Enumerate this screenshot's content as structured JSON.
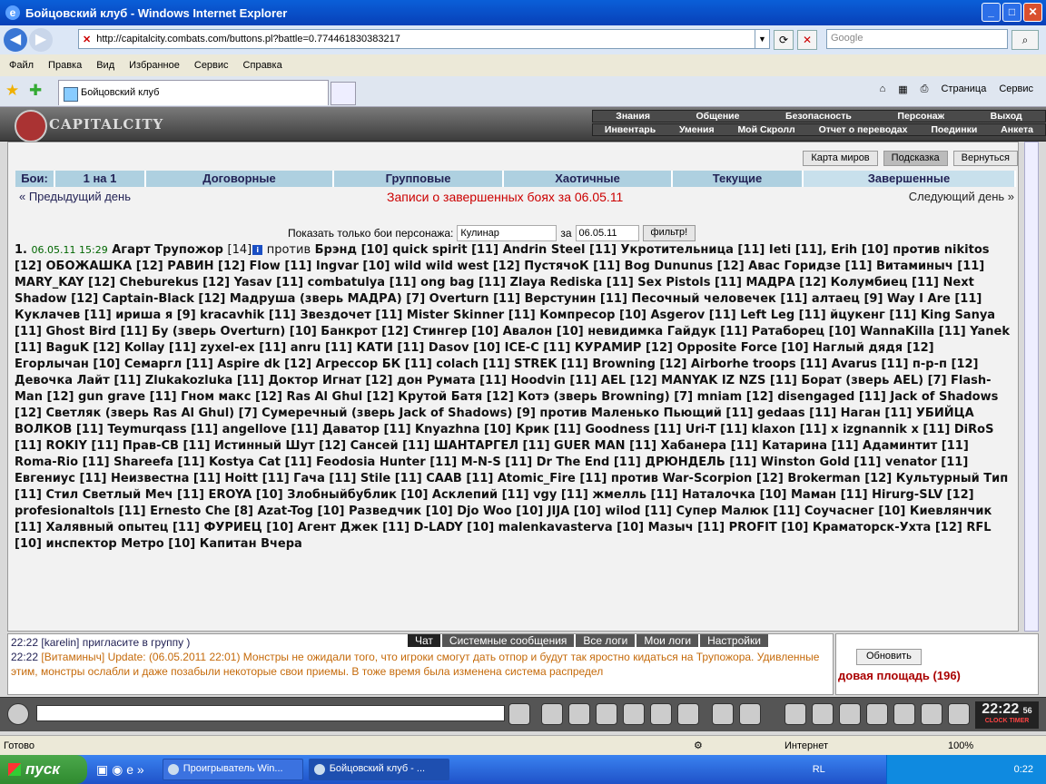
{
  "window": {
    "title": "Бойцовский клуб - Windows Internet Explorer",
    "minimize": "_",
    "maximize": "□",
    "close": "✕"
  },
  "address": {
    "url": "http://capitalcity.combats.com/buttons.pl?battle=0.774461830383217",
    "search_placeholder": "Google"
  },
  "menu": [
    "Файл",
    "Правка",
    "Вид",
    "Избранное",
    "Сервис",
    "Справка"
  ],
  "tab": {
    "title": "Бойцовский клуб"
  },
  "ie_toolbar": {
    "page": "Страница",
    "service": "Сервис"
  },
  "game": {
    "logo": "CAPITALCITY",
    "menu_row1": [
      "Знания",
      "Общение",
      "Безопасность",
      "Персонаж",
      "Выход"
    ],
    "menu_row2": [
      "Инвентарь",
      "Умения",
      "Мой Скролл",
      "Отчет о переводах",
      "Поединки",
      "Анкета"
    ],
    "top_buttons": [
      "Карта миров",
      "Подсказка",
      "Вернуться"
    ],
    "fights_label": "Бои:",
    "fight_tabs": [
      "1 на 1",
      "Договорные",
      "Групповые",
      "Хаотичные",
      "Текущие",
      "Завершенные"
    ],
    "prev_day": "« Предыдущий день",
    "heading": "Записи о завершенных боях за 06.05.11",
    "next_day": "Следующий день »",
    "filter_label": "Показать только бои персонажа:",
    "filter_name": "Кулинар",
    "filter_for": "за",
    "filter_date": "06.05.11",
    "filter_button": "фильтр!",
    "battle_num": "1.",
    "battle_time": "06.05.11 15:29",
    "battle_head": "Агарт Трупожор",
    "battle_head_lvl": "[14]",
    "vs": "против",
    "battle_text_rest": "Брэнд [10] quick spirit [11] Andrin Steel [11] Укротительница [11] Ieti [11], Erih [10] против nikitos [12] ОБОЖАШКА [12] РАВИН [12] Flow [11] Ingvar [10] wild wild west [12] ПустячоК [11] Bog Dununus [12] Авас Горидзе [11] Витаминыч [11] MARY_KAY [12] Cheburekus [12] Yasav [11] combatulya [11] ong bag [11] Zlaya Rediska [11] Sex Pistols [11] МАДРА [12] Колумбиец [11] Next Shadow [12] Captain-Black [12] Мадруша (зверь МАДРА) [7] Overturn [11] Верстунин [11] Песочный человечек [11] алтаец [9] Way I Are [11] Куклачев [11] ириша я [9] kracavhik [11] Звездочет [11] Mister Skinner [11] Компресор [10] Asgerov [11] Left Leg [11] йцукенг [11] King Sanya [11] Ghost Bird [11] Бу (зверь Overturn) [10] Банкрот [12] Стингер [10] Авалон [10] невидимка Гайдук [11] Ратаборец [10] WannaKilla [11] Yanek [11] BaguK [12] Kollay [11] zyxel-ex [11] anru [11] КАТИ [11] Dasov [10] ICE-C [11] КУРАМИР [12] Opposite Force [10] Наглый дядя [12] Егорлычан [10] Семаргл [11] Aspire dk [12] Агрессор БК [11] colach [11] STREK [11] Browning [12] Airborhe troops [11] Avarus [11] п-р-п [12] Девочка Лайт [11] Zlukakozluka [11] Доктор Игнат [12] дон Румата [11] Hoodvin [11] AEL [12] MANYAK IZ NZS [11] Борат (зверь AEL) [7] Flash-Man [12] gun grave [11] Гном макс [12] Ras Al Ghul [12] Крутой Батя [12] Котэ (зверь Browning) [7] mniam [12] disengaged [11] Jack of Shadows [12] Светляк (зверь Ras Al Ghul) [7] Сумеречный (зверь Jack of Shadows) [9] против Маленько Пьющий [11] gedaas [11] Наган [11] УБИЙЦА ВОЛКОВ [11] Teymurqass [11] angellove [11] Даватор [11] Knyazhna [10] Крик [11] Goodness [11] Uri-T [11] klaxon [11] x izgnannik x [11] DiRoS [11] ROKIY [11] Прав-СВ [11] Истинный Шут [12] Сансей [11] ШАНТАРГЕЛ [11] GUER MAN [11] Хабанера [11] Катарина [11] Адаминтит [11] Roma-Rio [11] Shareefa [11] Kostya Cat [11] Feodosia Hunter [11] M-N-S [11] Dr The End [11] ДРЮНДЕЛЬ [11] Winston Gold [11] venator [11] Евгениус [11] Неизвестна [11] Hoitt [11] Гача [11] Stile [11] CAAB [11] Atomic_Fire [11] против War-Scorpion [12] Brokerman [12] Культурный Тип [11] Стил Светлый Меч [11] EROYA [10] Злобныйбублик [10] Асклепий [11] vgy [11] жмелль [11] Наталочка [10] Маман [11] Hirurg-SLV [12] profesionaltols [11] Ernesto Che [8] Azat-Tog [10] Разведчик [10] Djo Woo [10] JIJA [10] wilod [11] Супер Малюк [11] Соучаснег [10] Киевлянчик [11] Халявный опытец [11] ФУРИЕЦ [10] Агент Джек [11] D-LADY [10] malenkavasterva [10] Мазыч [11] PROFIT [10] Краматорск-Ухта [12] RFL [10] инспектор Метро [10] Капитан Вчера"
  },
  "chat": {
    "tabs": [
      "Чат",
      "Системные сообщения",
      "Все логи",
      "Мои логи",
      "Настройки"
    ],
    "line1_time": "22:22",
    "line1_text": "[karelin] пригласите в группу )",
    "line2_time": "22:22",
    "line2_text": "[Витаминыч] Update: (06.05.2011 22:01) Монстры не ожидали того, что игроки смогут дать отпор и будут так яростно кидаться на Трупожора. Удивленные этим, монстры ослабли и даже позабыли некоторые свои приемы. В тоже время была изменена система распредел",
    "refresh_button": "Обновить",
    "location": "довая площадь (196)"
  },
  "clock": {
    "time": "22:22",
    "seconds": "56",
    "label": "CLOCK TIMER"
  },
  "status": {
    "left": "Готово",
    "zone": "Интернет",
    "zoom": "100%"
  },
  "taskbar": {
    "start": "пуск",
    "tasks": [
      "Проигрыватель Win...",
      "Бойцовский клуб - ..."
    ],
    "lang": "RL",
    "time": "0:22"
  }
}
